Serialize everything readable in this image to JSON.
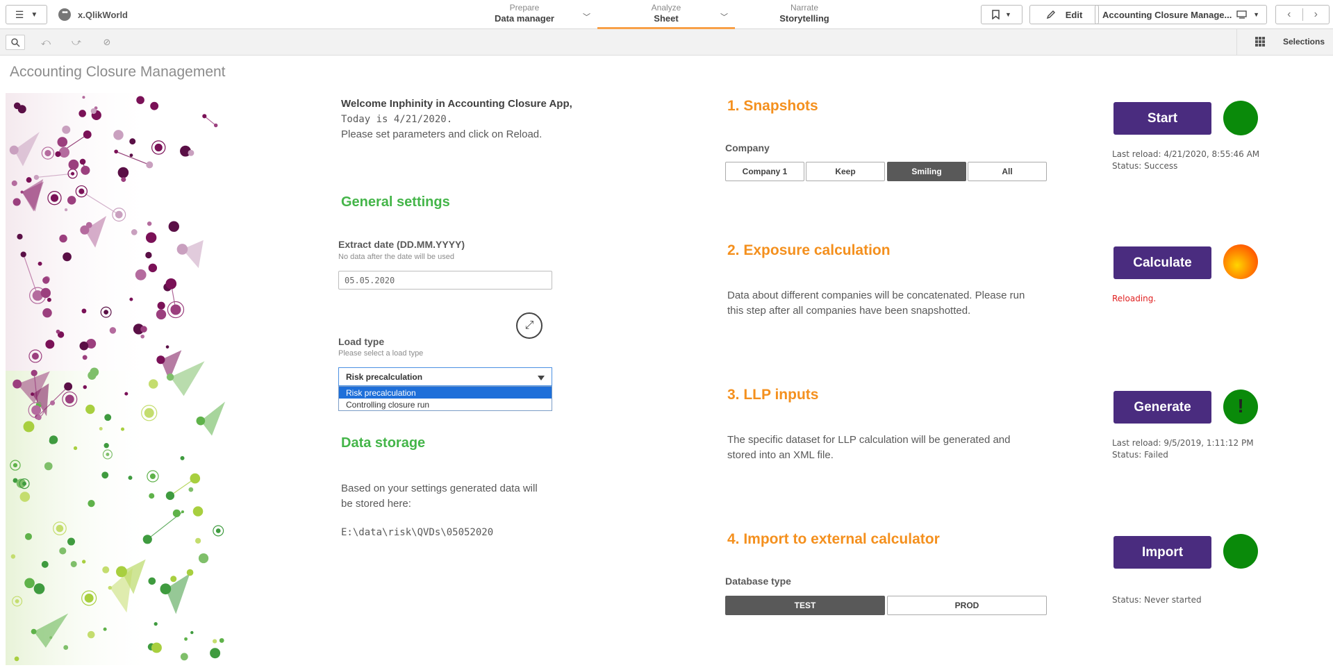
{
  "topbar": {
    "app_name": "x.QlikWorld",
    "tabs": [
      {
        "sub": "Prepare",
        "main": "Data manager"
      },
      {
        "sub": "Analyze",
        "main": "Sheet"
      },
      {
        "sub": "Narrate",
        "main": "Storytelling"
      }
    ],
    "edit_label": "Edit",
    "sheet_selector": "Accounting Closure Manage..."
  },
  "toolbar": {
    "selections_label": "Selections"
  },
  "sheet_title": "Accounting Closure Management",
  "welcome": {
    "line1": "Welcome Inphinity in Accounting Closure App,",
    "line2": "Today is 4/21/2020.",
    "line3": "Please set parameters and click on Reload."
  },
  "general": {
    "heading": "General settings",
    "extract_label": "Extract date (DD.MM.YYYY)",
    "extract_sub": "No data after the date will be used",
    "extract_value": "05.05.2020",
    "load_label": "Load type",
    "load_sub": "Please select a load type",
    "load_value": "Risk precalculation",
    "load_options": [
      "Risk precalculation",
      "Controlling closure run"
    ]
  },
  "storage": {
    "heading": "Data storage",
    "text_line1": "Based on your settings generated data will",
    "text_line2": "be stored here:",
    "path": "E:\\data\\risk\\QVDs\\05052020"
  },
  "steps": {
    "s1": {
      "heading": "1. Snapshots",
      "filter_label": "Company",
      "options": [
        "Company 1",
        "Keep",
        "Smiling",
        "All"
      ],
      "selected": "Smiling",
      "button": "Start",
      "status_line1": "Last reload: 4/21/2020, 8:55:46 AM",
      "status_line2": "Status: Success",
      "dot_color": "#0a8a0a"
    },
    "s2": {
      "heading": "2. Exposure calculation",
      "desc_line1": "Data about different companies will be concatenated. Please run",
      "desc_line2": "this step after all companies have been snapshotted.",
      "button": "Calculate",
      "status_line1": "Reloading.",
      "dot_color": "#ff8800"
    },
    "s3": {
      "heading": "3. LLP inputs",
      "desc_line1": "The specific dataset for LLP calculation will be generated and",
      "desc_line2": "stored into an XML file.",
      "button": "Generate",
      "alert_mark": "!",
      "status_line1": "Last reload: 9/5/2019, 1:11:12 PM",
      "status_line2": "Status: Failed",
      "dot_color": "#0a8a0a"
    },
    "s4": {
      "heading": "4. Import to external calculator",
      "filter_label": "Database type",
      "options": [
        "TEST",
        "PROD"
      ],
      "selected": "TEST",
      "button": "Import",
      "status_line1": "Status: Never started",
      "dot_color": "#0a8a0a"
    }
  }
}
